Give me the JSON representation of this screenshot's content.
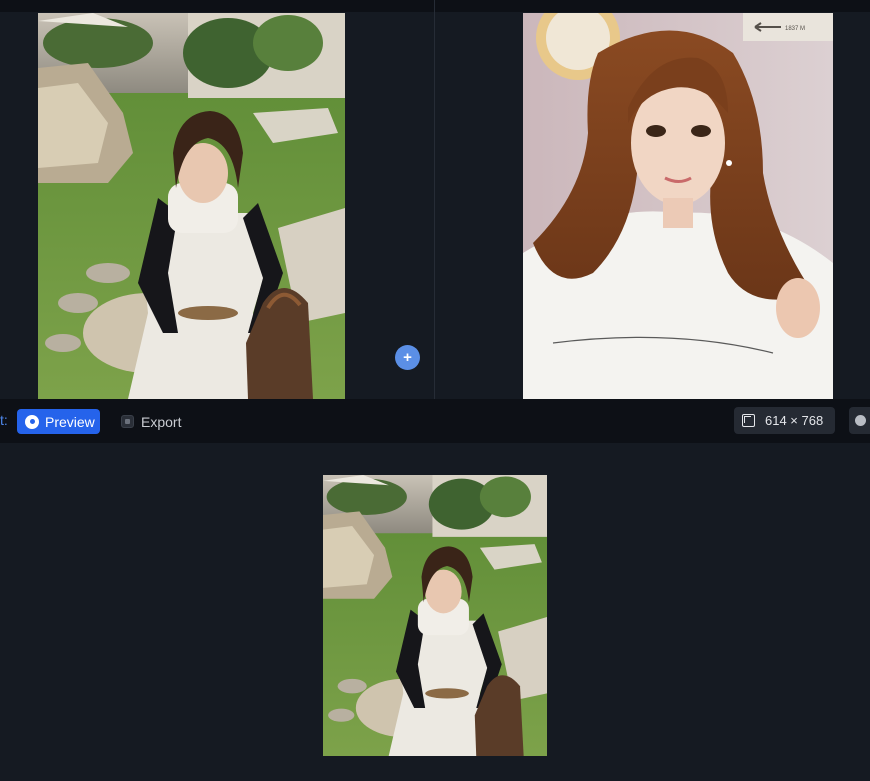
{
  "toolbar": {
    "label_fragment": "t:",
    "preview_label": "Preview",
    "export_label": "Export",
    "dimensions": "614 × 768"
  },
  "icons": {
    "preview": "eye-icon",
    "export": "export-icon",
    "dimensions": "resize-icon",
    "add": "plus-icon",
    "help": "help-icon"
  },
  "add_button": {
    "label": "+"
  },
  "reference_photo": {
    "sign_text": "1837 M"
  },
  "colors": {
    "accent": "#2563eb",
    "background": "#151a22",
    "toolbar": "#0d1016"
  }
}
